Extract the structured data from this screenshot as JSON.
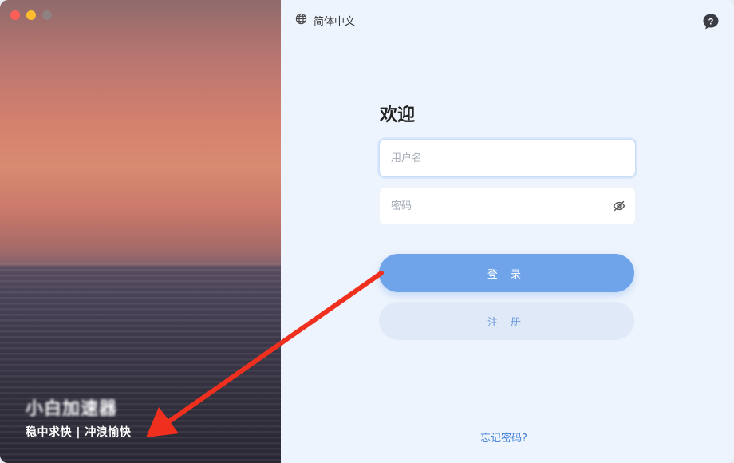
{
  "window": {
    "traffic_lights": [
      "close",
      "minimize",
      "zoom"
    ]
  },
  "brand": {
    "name": "小白加速器",
    "slogan": "稳中求快 | 冲浪愉快"
  },
  "header": {
    "language_label": "简体中文",
    "language_icon": "globe-icon",
    "help_icon": "help-bubble-icon"
  },
  "login": {
    "title": "欢迎",
    "username_placeholder": "用户名",
    "password_placeholder": "密码",
    "password_toggle_icon": "eye-slash-icon",
    "login_label": "登 录",
    "register_label": "注 册",
    "forgot_label": "忘记密码?"
  },
  "colors": {
    "primary": "#6fa3ea",
    "secondary_bg": "#dfe9f8",
    "panel_bg": "#eef4fd",
    "link": "#3f7fd6",
    "annotation_arrow": "#f0301e"
  }
}
